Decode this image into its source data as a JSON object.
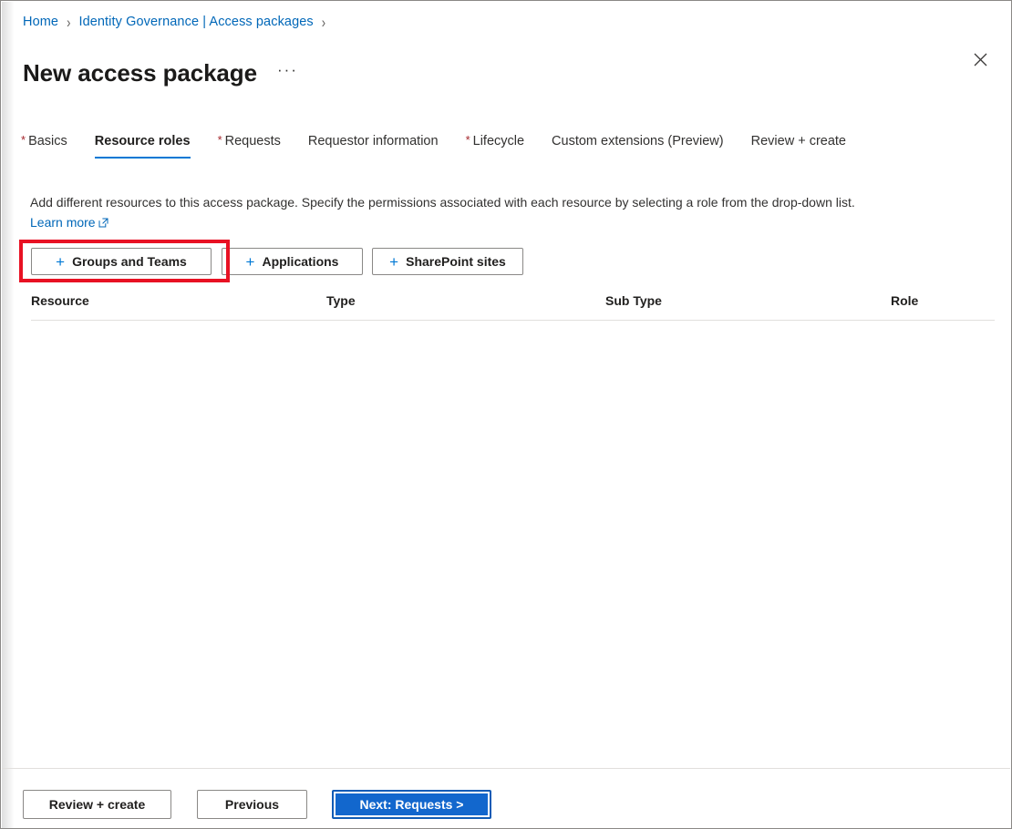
{
  "breadcrumb": {
    "items": [
      {
        "label": "Home"
      },
      {
        "label": "Identity Governance | Access packages"
      }
    ],
    "separator": "›"
  },
  "header": {
    "title": "New access package",
    "more_menu_label": "···",
    "close_icon": "close-icon"
  },
  "tabs": [
    {
      "label": "Basics",
      "required": "*",
      "selected": false
    },
    {
      "label": "Resource roles",
      "required": "",
      "selected": true
    },
    {
      "label": "Requests",
      "required": "*",
      "selected": false
    },
    {
      "label": "Requestor information",
      "required": "",
      "selected": false
    },
    {
      "label": "Lifecycle",
      "required": "*",
      "selected": false
    },
    {
      "label": "Custom extensions (Preview)",
      "required": "",
      "selected": false
    },
    {
      "label": "Review + create",
      "required": "",
      "selected": false
    }
  ],
  "description": {
    "text": "Add different resources to this access package. Specify the permissions associated with each resource by selecting a role from the drop-down list.",
    "link_label": "Learn more",
    "link_icon": "external-link-icon"
  },
  "resource_buttons": [
    {
      "id": "groups-and-teams",
      "label": "Groups and Teams",
      "icon": "plus-icon",
      "highlighted": true
    },
    {
      "id": "applications",
      "label": "Applications",
      "icon": "plus-icon",
      "highlighted": false
    },
    {
      "id": "sharepoint-sites",
      "label": "SharePoint sites",
      "icon": "plus-icon",
      "highlighted": false
    }
  ],
  "highlight": {
    "color": "#e81123",
    "target": "groups-and-teams"
  },
  "table": {
    "columns": [
      {
        "key": "resource",
        "label": "Resource"
      },
      {
        "key": "type",
        "label": "Type"
      },
      {
        "key": "subtype",
        "label": "Sub Type"
      },
      {
        "key": "role",
        "label": "Role"
      }
    ],
    "rows": []
  },
  "footer": {
    "review_create_label": "Review + create",
    "previous_label": "Previous",
    "next_label": "Next: Requests >"
  },
  "colors": {
    "link": "#0067b8",
    "accent": "#0078d4",
    "primary_button": "#1267cd",
    "required_asterisk": "#a4262c",
    "highlight": "#e81123"
  }
}
